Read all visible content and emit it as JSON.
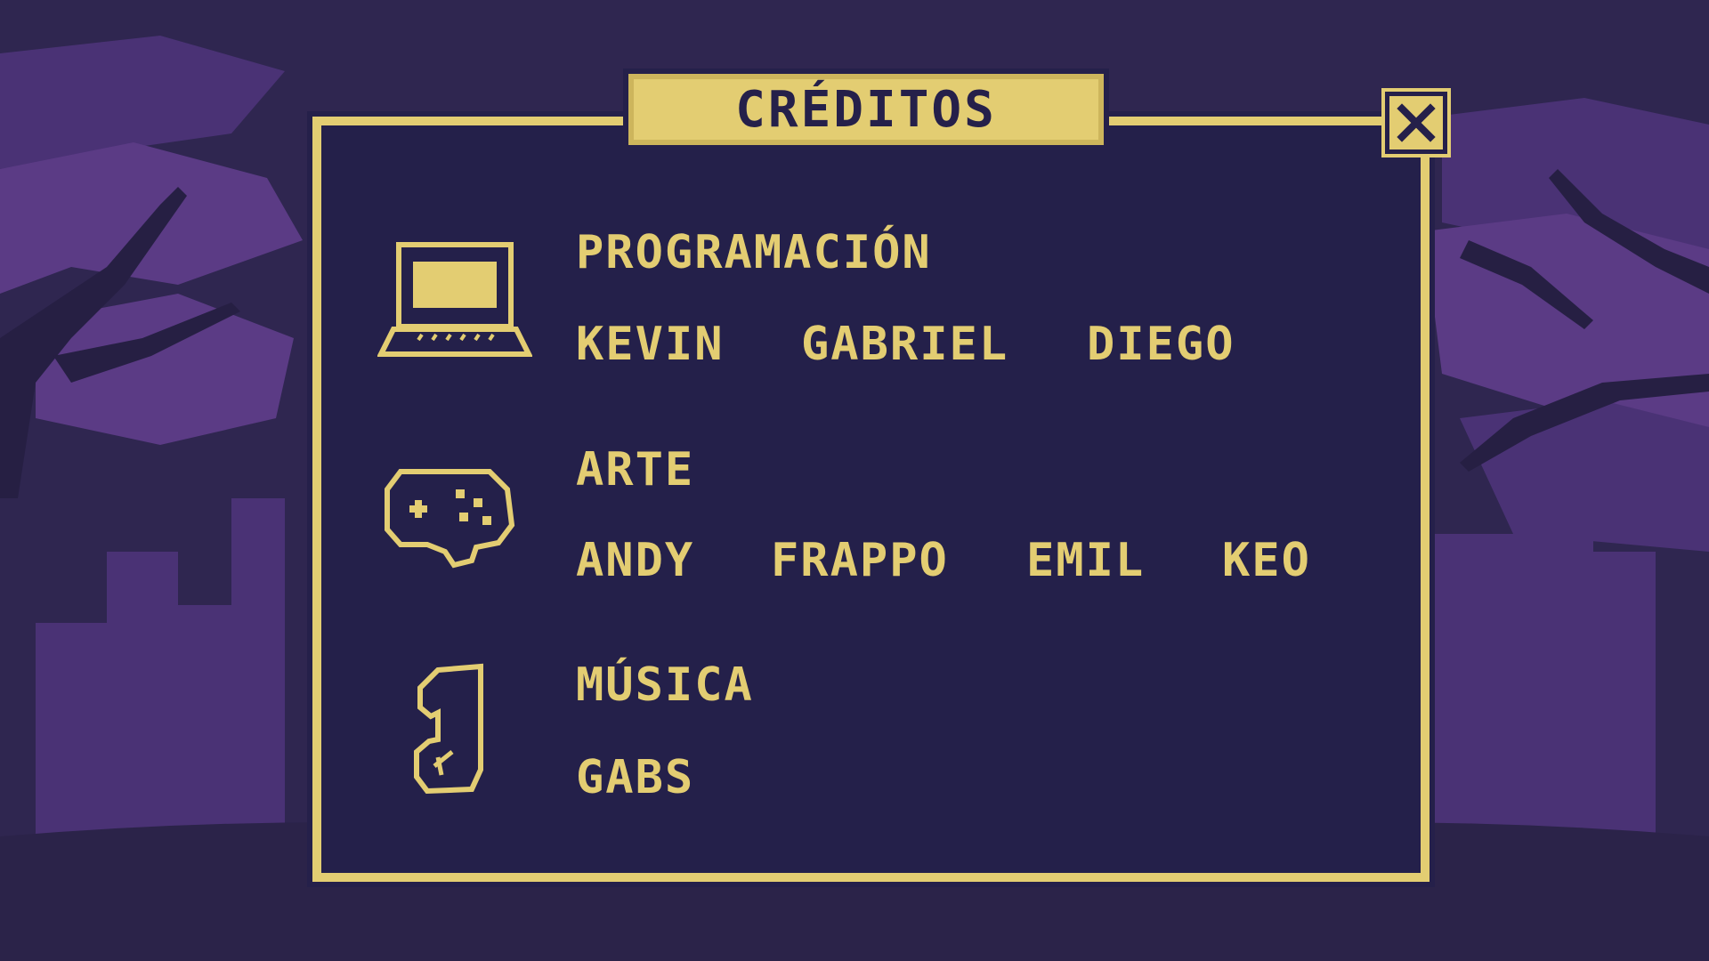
{
  "title": "CRÉDITOS",
  "close_icon": "close-icon",
  "colors": {
    "accent": "#e3cd72",
    "panel": "#24204a",
    "background": "#2f2650",
    "foliage": "#5b3b85"
  },
  "sections": [
    {
      "icon": "laptop-icon",
      "title": "PROGRAMACIÓN",
      "names": [
        "KEVIN",
        "GABRIEL",
        "DIEGO"
      ]
    },
    {
      "icon": "gamepad-icon",
      "title": "ARTE",
      "names": [
        "ANDY",
        "FRAPPO",
        "EMIL",
        "KEO"
      ]
    },
    {
      "icon": "music-note-icon",
      "title": "MÚSICA",
      "names": [
        "GABS"
      ]
    }
  ]
}
